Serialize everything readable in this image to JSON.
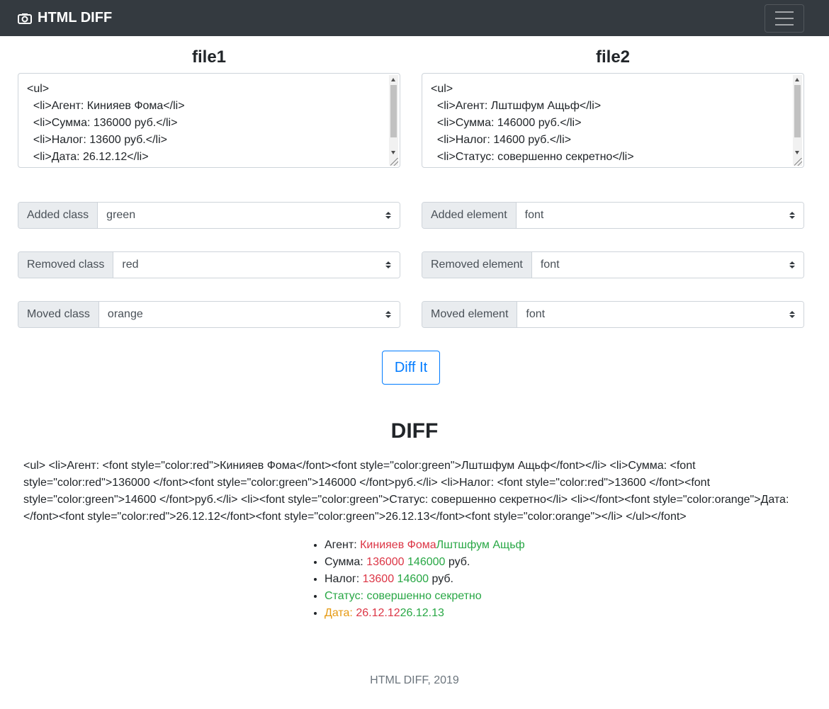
{
  "navbar": {
    "brand": "HTML DIFF",
    "brand_icon": "camera-icon",
    "menu_icon": "hamburger-menu-icon"
  },
  "file1": {
    "title": "file1",
    "content": "<ul>\n  <li>Агент: Кинияев Фома</li>\n  <li>Сумма: 136000 руб.</li>\n  <li>Налог: 13600 руб.</li>\n  <li>Дата: 26.12.12</li>"
  },
  "file2": {
    "title": "file2",
    "content": "<ul>\n  <li>Агент: Лштшфум Ащьф</li>\n  <li>Сумма: 146000 руб.</li>\n  <li>Налог: 14600 руб.</li>\n  <li>Статус: совершенно секретно</li>"
  },
  "options": {
    "added_class": {
      "label": "Added class",
      "value": "green"
    },
    "removed_class": {
      "label": "Removed class",
      "value": "red"
    },
    "moved_class": {
      "label": "Moved class",
      "value": "orange"
    },
    "added_element": {
      "label": "Added element",
      "value": "font"
    },
    "removed_element": {
      "label": "Removed element",
      "value": "font"
    },
    "moved_element": {
      "label": "Moved element",
      "value": "font"
    }
  },
  "diff_button": "Diff It",
  "diff": {
    "title": "DIFF",
    "raw": "<ul> <li>Агент: <font style=\"color:red\">Кинияев Фома</font><font style=\"color:green\">Лштшфум Ащьф</font></li> <li>Сумма: <font style=\"color:red\">136000 </font><font style=\"color:green\">146000 </font>руб.</li> <li>Налог: <font style=\"color:red\">13600 </font><font style=\"color:green\">14600 </font>руб.</li> <li><font style=\"color:green\">Статус: совершенно секретно</li> <li></font><font style=\"color:orange\">Дата: </font><font style=\"color:red\">26.12.12</font><font style=\"color:green\">26.12.13</font><font style=\"color:orange\"></li> </ul></font>",
    "items": [
      {
        "label": "Агент: ",
        "removed": "Кинияев Фома",
        "added": "Лштшфум Ащьф",
        "suffix": ""
      },
      {
        "label": "Сумма: ",
        "removed": "136000",
        "added": "146000",
        "suffix": " руб."
      },
      {
        "label": "Налог: ",
        "removed": "13600",
        "added": "14600",
        "suffix": " руб."
      },
      {
        "added_full": "Статус: совершенно секретно"
      },
      {
        "moved": "Дата: ",
        "removed": "26.12.12",
        "added": "26.12.13"
      }
    ]
  },
  "footer": "HTML DIFF, 2019",
  "colors": {
    "navbar_bg": "#343a40",
    "red": "#dc3545",
    "green": "#28a745",
    "orange": "#e69a12",
    "primary": "#007bff"
  }
}
